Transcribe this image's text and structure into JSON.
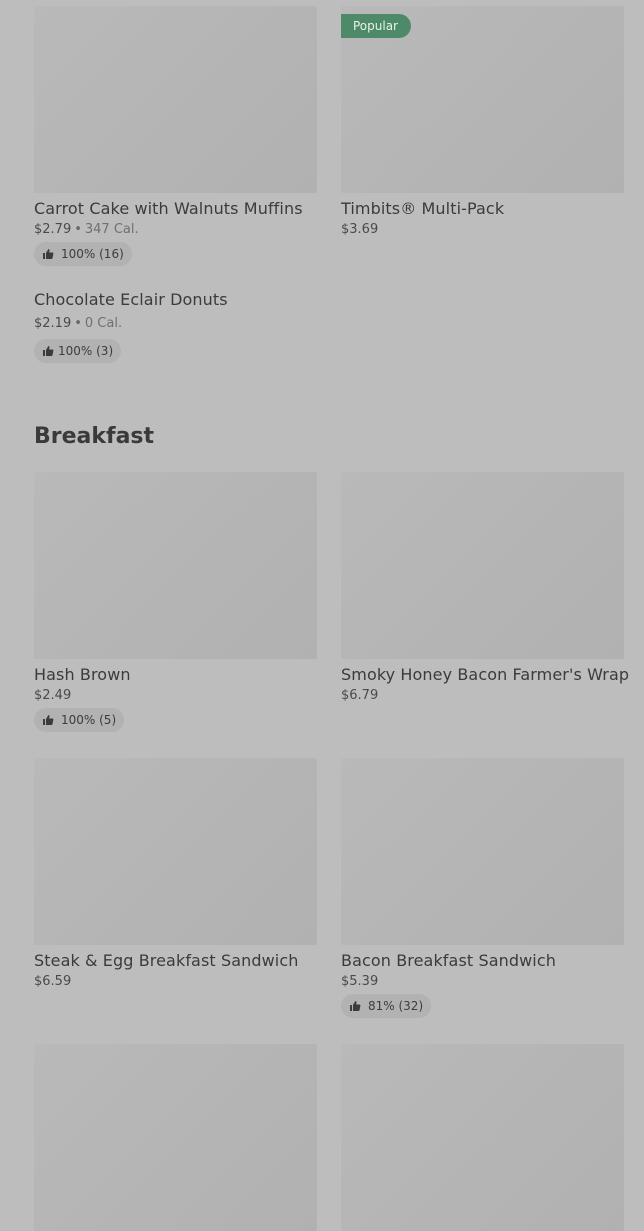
{
  "top_items": [
    {
      "name": "Carrot Cake with Walnuts Muffins",
      "price": "$2.79",
      "calories": "347 Cal.",
      "rating": "100% (16)",
      "popular": ""
    },
    {
      "name": "Timbits® Multi-Pack",
      "price": "$3.69",
      "calories": "",
      "rating": "",
      "popular": "Popular"
    }
  ],
  "text_item": {
    "name": "Chocolate Eclair Donuts",
    "price": "$2.19",
    "calories": "0 Cal.",
    "rating": "100% (3)"
  },
  "section": {
    "title": "Breakfast"
  },
  "breakfast_items": [
    {
      "name": "Hash Brown",
      "price": "$2.49",
      "rating": "100% (5)"
    },
    {
      "name": "Smoky Honey Bacon Farmer's Wrap",
      "price": "$6.79",
      "rating": ""
    },
    {
      "name": "Steak & Egg Breakfast Sandwich",
      "price": "$6.59",
      "rating": ""
    },
    {
      "name": "Bacon Breakfast Sandwich",
      "price": "$5.39",
      "rating": "81% (32)"
    }
  ],
  "icons": {
    "thumb_up": "thumb-up-icon"
  },
  "colors": {
    "popular_badge": "#4d8a69",
    "overlay": "#bdbdbd"
  }
}
